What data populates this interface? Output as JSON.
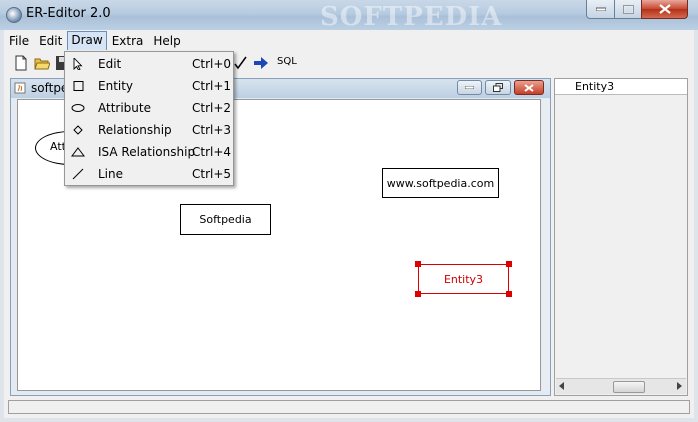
{
  "window": {
    "title": "ER-Editor 2.0",
    "watermark": "SOFTPEDIA"
  },
  "menubar": [
    "File",
    "Edit",
    "Draw",
    "Extra",
    "Help"
  ],
  "toolbar": {
    "sql_label": "SQL"
  },
  "internal_frame": {
    "title": "softpe"
  },
  "canvas": {
    "attribute_partial": "Att",
    "entities": [
      "www.softpedia.com",
      "Softpedia",
      "Entity3"
    ]
  },
  "draw_menu": [
    {
      "label": "Edit",
      "shortcut": "Ctrl+0",
      "icon": "arrow-cursor-icon"
    },
    {
      "label": "Entity",
      "shortcut": "Ctrl+1",
      "icon": "rectangle-icon"
    },
    {
      "label": "Attribute",
      "shortcut": "Ctrl+2",
      "icon": "ellipse-icon"
    },
    {
      "label": "Relationship",
      "shortcut": "Ctrl+3",
      "icon": "diamond-icon"
    },
    {
      "label": "ISA Relationship",
      "shortcut": "Ctrl+4",
      "icon": "triangle-icon"
    },
    {
      "label": "Line",
      "shortcut": "Ctrl+5",
      "icon": "line-icon"
    }
  ],
  "panel": {
    "rows": [
      "Entity3"
    ]
  },
  "colors": {
    "selection": "#d00000",
    "menu_highlight": "#d6e5f5"
  }
}
